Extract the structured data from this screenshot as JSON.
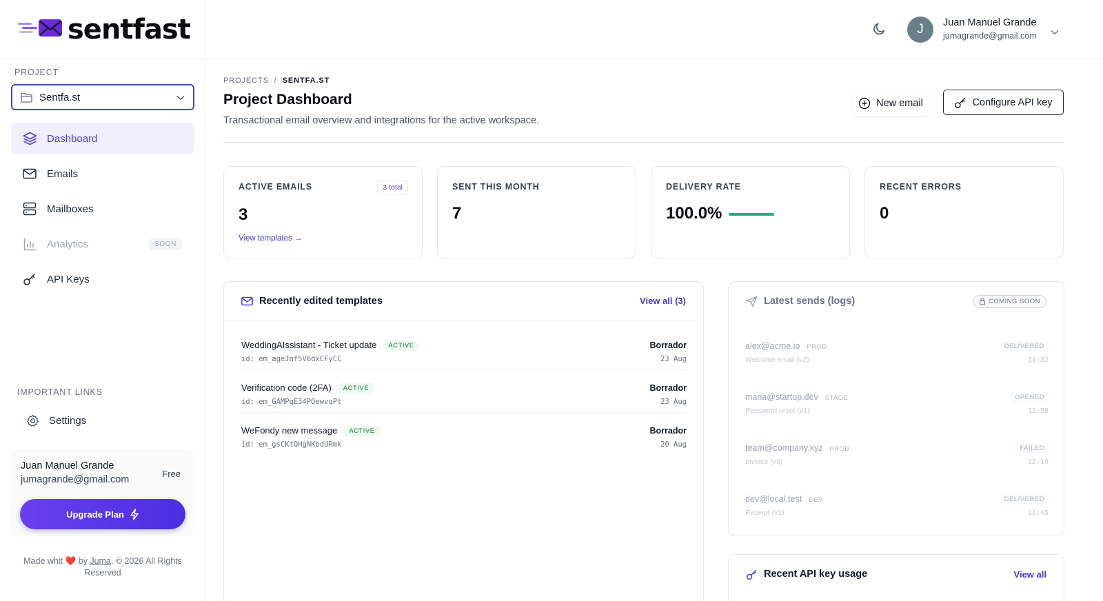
{
  "app": {
    "brand": "sentfast"
  },
  "sidebar": {
    "project_label": "PROJECT",
    "project_selected": "Sentfa.st",
    "nav": [
      {
        "label": "Dashboard",
        "icon": "layers-icon",
        "active": true
      },
      {
        "label": "Emails",
        "icon": "mail-icon"
      },
      {
        "label": "Mailboxes",
        "icon": "server-icon"
      },
      {
        "label": "Analytics",
        "icon": "bar-chart-icon",
        "badge": "SOON",
        "disabled": true
      },
      {
        "label": "API Keys",
        "icon": "key-icon"
      }
    ],
    "links_label": "IMPORTANT LINKS",
    "settings_label": "Settings",
    "user": {
      "name": "Juan Manuel Grande",
      "email": "jumagrande@gmail.com",
      "plan": "Free"
    },
    "upgrade_label": "Upgrade Plan",
    "footer": {
      "prefix": "Made whit",
      "heart": "❤️",
      "by": "by",
      "author": "Juma",
      "suffix": ". © 2026 All Rights Reserved"
    }
  },
  "header": {
    "user_initial": "J",
    "user_name": "Juan Manuel Grande",
    "user_email": "jumagrande@gmail.com"
  },
  "main": {
    "breadcrumb": {
      "root": "PROJECTS",
      "sep": "/",
      "current": "SENTFA.ST"
    },
    "title": "Project Dashboard",
    "subtitle": "Transactional email overview and integrations for the active workspace.",
    "new_email_label": "New email",
    "configure_api_label": "Configure API key",
    "stats": {
      "active_emails": {
        "label": "ACTIVE EMAILS",
        "value": "3",
        "badge": "3 total",
        "link": "View templates →"
      },
      "sent_month": {
        "label": "SENT THIS MONTH",
        "value": "7"
      },
      "delivery_rate": {
        "label": "DELIVERY RATE",
        "value": "100.0%",
        "fraction": 1.0
      },
      "recent_errors": {
        "label": "RECENT ERRORS",
        "value": "0"
      }
    },
    "templates": {
      "title": "Recently edited templates",
      "view_all": "View all (3)",
      "rows": [
        {
          "name": "WeddingAIssistant - Ticket update",
          "status_badge": "ACTIVE",
          "id": "id: em_ageJnf5V6dxCFyCC",
          "state": "Borrador",
          "date": "23 Aug"
        },
        {
          "name": "Verification code (2FA)",
          "status_badge": "ACTIVE",
          "id": "id: em_GAMPqE34PQewvqPt",
          "state": "Borrador",
          "date": "23 Aug"
        },
        {
          "name": "WeFondy new message",
          "status_badge": "ACTIVE",
          "id": "id: em_gsCKtQHgNKbdURmk",
          "state": "Borrador",
          "date": "20 Aug"
        }
      ]
    },
    "logs": {
      "title": "Latest sends (logs)",
      "badge": "COMING SOON",
      "rows": [
        {
          "email": "alex@acme.io",
          "env": "PROD",
          "desc": "Welcome email (v2)",
          "status": "DELIVERED",
          "time": "14:32"
        },
        {
          "email": "maria@startup.dev",
          "env": "STAGE",
          "desc": "Password reset (v1)",
          "status": "OPENED",
          "time": "13:58"
        },
        {
          "email": "team@company.xyz",
          "env": "PROD",
          "desc": "Invoice (v3)",
          "status": "FAILED",
          "time": "12:10"
        },
        {
          "email": "dev@local.test",
          "env": "DEV",
          "desc": "Receipt (v1)",
          "status": "DELIVERED",
          "time": "11:45"
        }
      ]
    },
    "api_usage": {
      "title": "Recent API key usage",
      "view_all": "View all"
    }
  },
  "colors": {
    "accent": "#4f3fd6",
    "success": "#22b07d",
    "border": "#e5e7eb"
  }
}
